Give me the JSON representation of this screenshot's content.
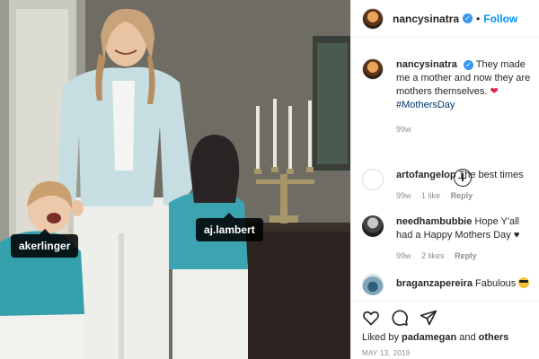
{
  "post": {
    "username": "nancysinatra",
    "follow_label": "Follow",
    "caption_user": "nancysinatra",
    "caption_text": "They made me a mother and now they are mothers themselves.",
    "caption_hashtag": "#MothersDay",
    "caption_age": "99w",
    "tags": [
      "akerlinger",
      "aj.lambert"
    ]
  },
  "comments": [
    {
      "user": "artofangelop",
      "text": "The best times",
      "age": "99w",
      "likes": "1 like",
      "reply": "Reply"
    },
    {
      "user": "needhambubbie",
      "text": "Hope Y'all had a Happy Mothers Day",
      "age": "99w",
      "likes": "2 likes",
      "reply": "Reply"
    },
    {
      "user": "braganzapereira",
      "text": "Fabulous"
    }
  ],
  "footer": {
    "liked_prefix": "Liked by",
    "liked_user": "padamegan",
    "liked_and": "and",
    "liked_others": "others",
    "date": "MAY 13, 2019"
  },
  "colors": {
    "link_blue": "#0095f6",
    "verified_blue": "#3897f0",
    "hashtag_blue": "#00376b",
    "muted_gray": "#8e8e8e"
  },
  "icons": [
    "verified-badge-icon",
    "add-comment-icon",
    "heart-icon",
    "comment-icon",
    "share-icon",
    "red-heart-emoji-icon",
    "sunglasses-emoji-icon"
  ]
}
